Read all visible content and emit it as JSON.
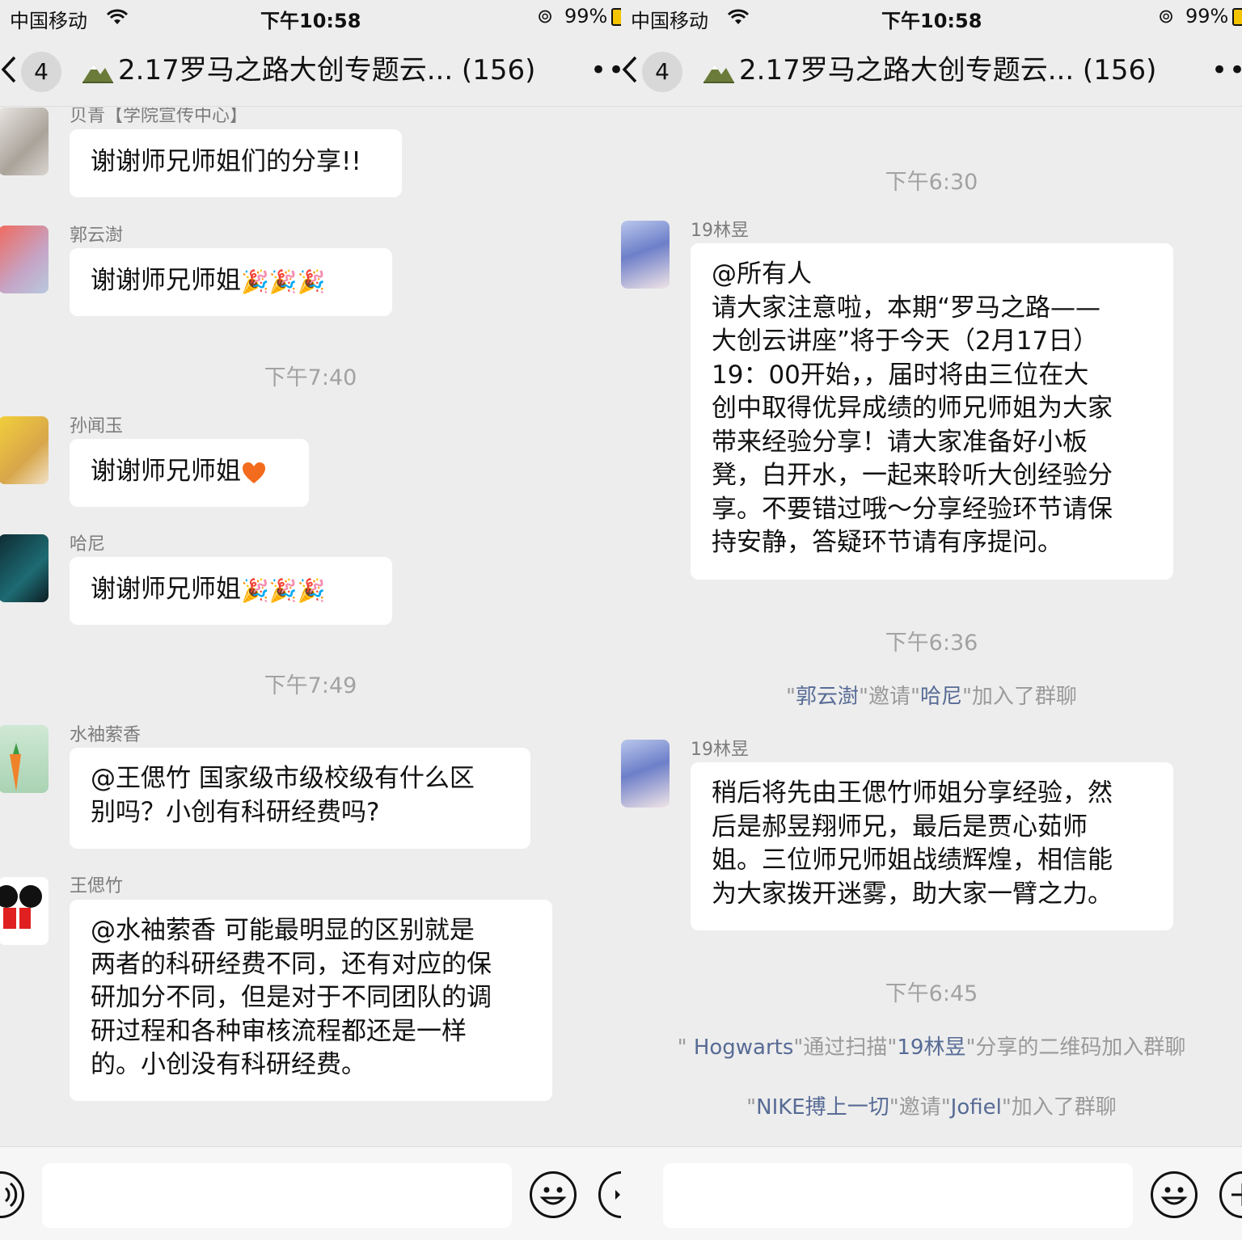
{
  "status": {
    "carrier": "中国移动",
    "time": "下午10:58",
    "battery": "99%"
  },
  "nav": {
    "unread": "4",
    "title": "2.17罗马之路大创专题云... (156)",
    "more": "•••"
  },
  "left": {
    "messages": [
      {
        "sender": "贝青【学院宣传中心】",
        "text": "谢谢师兄师姐们的分享!!"
      },
      {
        "sender": "郭云澍",
        "text": "谢谢师兄师姐",
        "emoji": "🎉🎉🎉"
      },
      {
        "time": "下午7:40"
      },
      {
        "sender": "孙闻玉",
        "text": "谢谢师兄师姐",
        "emoji": "heart"
      },
      {
        "sender": "哈尼",
        "text": "谢谢师兄师姐",
        "emoji": "🎉🎉🎉"
      },
      {
        "time": "下午7:49"
      },
      {
        "sender": "水袖萦香",
        "text": "@王偲竹 国家级市级校级有什么区\n别吗？小创有科研经费吗?"
      },
      {
        "sender": "王偲竹",
        "text": "@水袖萦香 可能最明显的区别就是\n两者的科研经费不同，还有对应的保\n研加分不同，但是对于不同团队的调\n研过程和各种审核流程都还是一样\n的。小创没有科研经费。"
      }
    ]
  },
  "right": {
    "time1": "下午6:30",
    "msg1": {
      "sender": "19林昱",
      "text": "@所有人\n请大家注意啦，本期“罗马之路——\n大创云讲座”将于今天（2月17日）\n19：00开始，，届时将由三位在大\n创中取得优异成绩的师兄师姐为大家\n带来经验分享！请大家准备好小板\n凳，白开水，一起来聆听大创经验分\n享。不要错过哦～分享经验环节请保\n持安静，答疑环节请有序提问。"
    },
    "time2": "下午6:36",
    "sys1": {
      "q1": "\"",
      "a": "郭云澍",
      "q2": "\"邀请\"",
      "b": "哈尼",
      "q3": "\"加入了群聊"
    },
    "msg2": {
      "sender": "19林昱",
      "text": "稍后将先由王偲竹师姐分享经验，然\n后是郝昱翔师兄，最后是贾心茹师\n姐。三位师兄师姐战绩辉煌，相信能\n为大家拨开迷雾，助大家一臂之力。"
    },
    "time3": "下午6:45",
    "sys2": {
      "q1": "\" ",
      "a": "Hogwarts",
      "q2": "\"通过扫描\"",
      "b": "19林昱",
      "q3": "\"分享的二维码加入群聊"
    },
    "sys3": {
      "q1": "\"",
      "a": "NIKE搏上一切",
      "q2": "\"邀请\"",
      "b": "Jofiel",
      "q3": "\"加入了群聊"
    }
  },
  "colors": {
    "background": "#ededed",
    "bubble": "#ffffff",
    "link": "#576b95",
    "battery": "#f5c400"
  }
}
